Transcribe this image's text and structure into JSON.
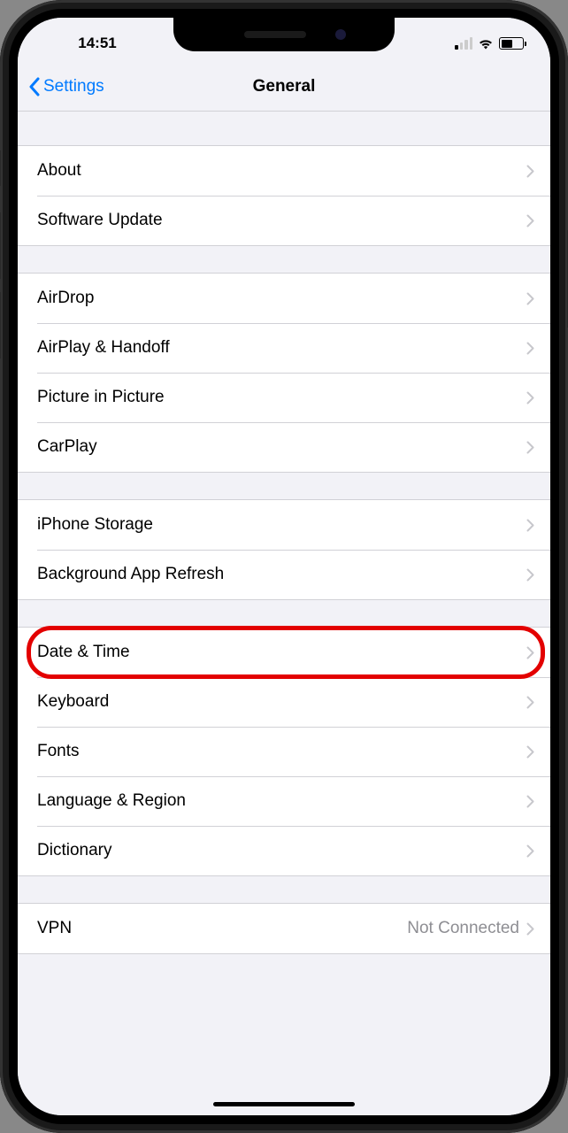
{
  "statusBar": {
    "time": "14:51"
  },
  "nav": {
    "backLabel": "Settings",
    "title": "General"
  },
  "groups": [
    {
      "items": [
        {
          "id": "about",
          "label": "About"
        },
        {
          "id": "software-update",
          "label": "Software Update"
        }
      ]
    },
    {
      "items": [
        {
          "id": "airdrop",
          "label": "AirDrop"
        },
        {
          "id": "airplay-handoff",
          "label": "AirPlay & Handoff"
        },
        {
          "id": "picture-in-picture",
          "label": "Picture in Picture"
        },
        {
          "id": "carplay",
          "label": "CarPlay"
        }
      ]
    },
    {
      "items": [
        {
          "id": "iphone-storage",
          "label": "iPhone Storage"
        },
        {
          "id": "background-app-refresh",
          "label": "Background App Refresh"
        }
      ]
    },
    {
      "items": [
        {
          "id": "date-time",
          "label": "Date & Time",
          "highlighted": true
        },
        {
          "id": "keyboard",
          "label": "Keyboard"
        },
        {
          "id": "fonts",
          "label": "Fonts"
        },
        {
          "id": "language-region",
          "label": "Language & Region"
        },
        {
          "id": "dictionary",
          "label": "Dictionary"
        }
      ]
    },
    {
      "items": [
        {
          "id": "vpn",
          "label": "VPN",
          "detail": "Not Connected"
        }
      ]
    }
  ]
}
